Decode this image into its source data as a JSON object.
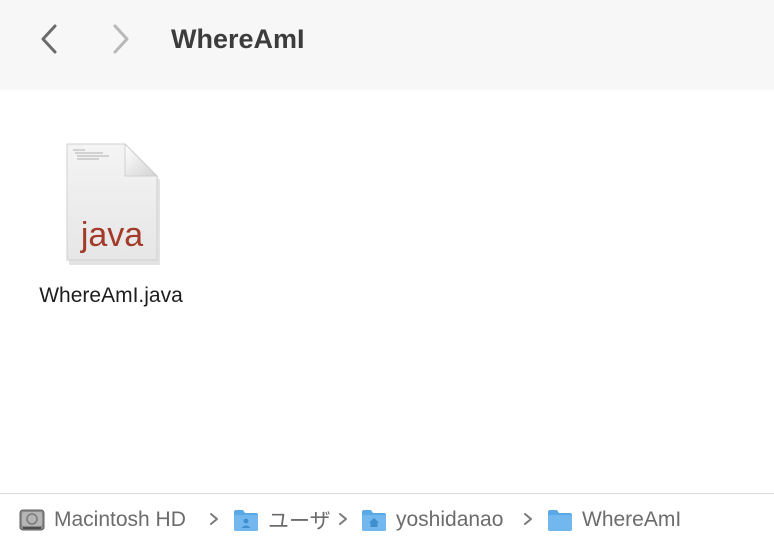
{
  "window": {
    "title": "WhereAmI"
  },
  "toolbar": {
    "back_icon": "chevron-left-icon",
    "forward_icon": "chevron-right-icon"
  },
  "files": [
    {
      "name": "WhereAmI.java",
      "icon": "java-file-icon",
      "icon_badge": "java",
      "badge_color": "#a33a2a"
    }
  ],
  "pathbar": {
    "items": [
      {
        "label": "Macintosh HD",
        "icon": "hard-drive-icon"
      },
      {
        "label": "ユーザ",
        "icon": "users-folder-icon"
      },
      {
        "label": "yoshidanao",
        "icon": "home-folder-icon"
      },
      {
        "label": "WhereAmI",
        "icon": "folder-icon"
      }
    ]
  },
  "colors": {
    "folder_blue": "#5aa9e6",
    "title_text": "#3c3c3c",
    "path_text": "#6c6c6c"
  }
}
